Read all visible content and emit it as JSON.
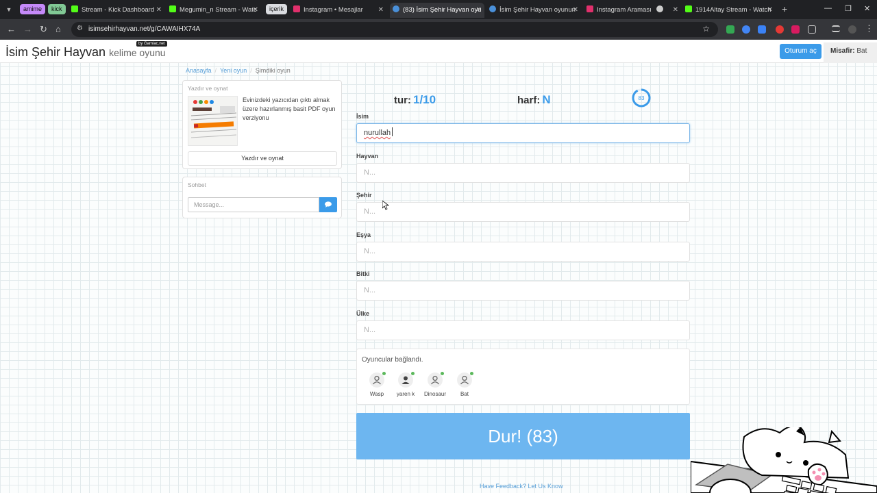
{
  "browser": {
    "groups": [
      {
        "label": "amime",
        "color": "#c58af9"
      },
      {
        "label": "kick",
        "color": "#81c995"
      }
    ],
    "tabs": [
      {
        "title": "Stream - Kick Dashboard",
        "favicon_color": "#53fc18",
        "active": false
      },
      {
        "title": "Megumin_n Stream - Watc",
        "favicon_color": "#53fc18",
        "active": false
      },
      {
        "title": "Instagram • Mesajlar",
        "favicon_color": "#e1306c",
        "active": false
      },
      {
        "title": "(83) İsim Şehir Hayvan oyu",
        "favicon_color": "#4a90d9",
        "active": true
      },
      {
        "title": "İsim Şehir Hayvan oyunun",
        "favicon_color": "#4a90d9",
        "active": false
      },
      {
        "title": "Instagram Araması",
        "favicon_color": "#e1306c",
        "active": false
      },
      {
        "title": "",
        "favicon_color": "#cccccc",
        "active": false
      },
      {
        "title": "1914Altay Stream - Watch",
        "favicon_color": "#53fc18",
        "active": false
      }
    ],
    "group_chip_icerik": "içerik",
    "url": "isimsehirhayvan.net/g/CAWAIHX74A"
  },
  "header": {
    "brand": "İsim Şehir Hayvan",
    "brand_sub": "kelime oyunu",
    "by": "by Gamiac.net",
    "login_label": "Oturum aç",
    "guest_label": "Misafir:",
    "guest_name": "Bat"
  },
  "breadcrumb": {
    "home": "Anasayfa",
    "new_game": "Yeni oyun",
    "current": "Şimdiki oyun"
  },
  "print_panel": {
    "title": "Yazdır ve oynat",
    "text": "Evinizdeki yazıcıdan çıktı almak üzere hazırlanmış basit PDF oyun verziyonu",
    "button": "Yazdır ve oynat"
  },
  "chat_panel": {
    "title": "Sohbet",
    "placeholder": "Message..."
  },
  "game": {
    "round_label": "tur:",
    "round_value": "1/10",
    "letter_label": "harf:",
    "letter_value": "N",
    "timer": "83",
    "timer_progress": 0.92,
    "fields": [
      {
        "label": "İsim",
        "value": "nurullah",
        "placeholder": "N..."
      },
      {
        "label": "Hayvan",
        "value": "",
        "placeholder": "N..."
      },
      {
        "label": "Şehir",
        "value": "",
        "placeholder": "N..."
      },
      {
        "label": "Eşya",
        "value": "",
        "placeholder": "N..."
      },
      {
        "label": "Bitki",
        "value": "",
        "placeholder": "N..."
      },
      {
        "label": "Ülke",
        "value": "",
        "placeholder": "N..."
      }
    ],
    "players_title": "Oyuncular bağlandı.",
    "players": [
      "Wasp",
      "yaren k",
      "Dinosaur",
      "Bat"
    ],
    "stop_button": "Dur! (83)"
  },
  "footer": {
    "feedback": "Have Feedback? Let Us Know"
  },
  "colors": {
    "accent": "#3b9be9",
    "stop_button": "#6db6f0",
    "online": "#5cb85c"
  }
}
